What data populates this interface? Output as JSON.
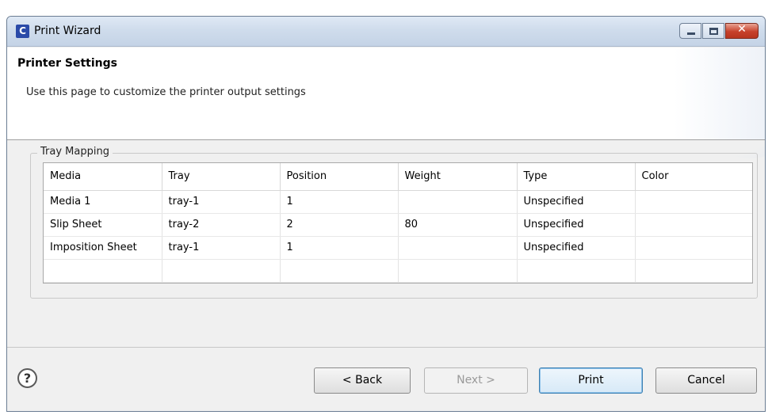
{
  "window": {
    "title": "Print Wizard",
    "app_icon_letter": "C",
    "controls": {
      "minimize": "minimize-icon",
      "maximize": "maximize-icon",
      "close": "close-icon",
      "close_glyph": "✕"
    }
  },
  "header": {
    "title": "Printer Settings",
    "description": "Use this page to customize the printer output settings"
  },
  "tray_mapping": {
    "label": "Tray Mapping",
    "columns": [
      "Media",
      "Tray",
      "Position",
      "Weight",
      "Type",
      "Color"
    ],
    "rows": [
      [
        "Media 1",
        "tray-1",
        "1",
        "",
        "Unspecified",
        ""
      ],
      [
        "Slip Sheet",
        "tray-2",
        "2",
        "80",
        "Unspecified",
        ""
      ],
      [
        "Imposition Sheet",
        "tray-1",
        "1",
        "",
        "Unspecified",
        ""
      ],
      [
        "",
        "",
        "",
        "",
        "",
        ""
      ]
    ]
  },
  "footer": {
    "help_glyph": "?",
    "back_label": "< Back",
    "next_label": "Next >",
    "print_label": "Print",
    "cancel_label": "Cancel"
  },
  "colors": {
    "accent": "#3c7fb1",
    "close_button": "#c7412b",
    "app_icon": "#2a4aa8"
  }
}
